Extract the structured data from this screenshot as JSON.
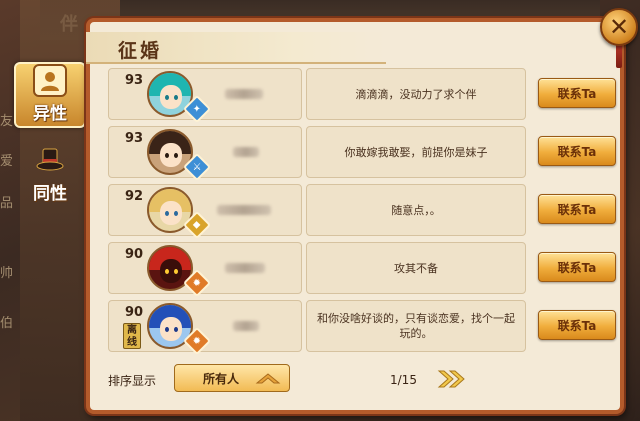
{
  "background": {
    "partial_title": "伴",
    "edge_chars": [
      "友",
      "爱",
      "品",
      "帅",
      "伯"
    ]
  },
  "side_tabs": [
    {
      "label": "异性",
      "icon": "person-silhouette-icon",
      "active": true
    },
    {
      "label": "同性",
      "icon": "top-hat-icon",
      "active": false
    }
  ],
  "dialog": {
    "title": "征婚",
    "close_icon": "close-x-icon"
  },
  "rows": [
    {
      "level": "93",
      "avatar": "teal-twin-tail-girl",
      "badge": "star",
      "message": "滴滴滴，没动力了求个伴",
      "button": "联系Ta",
      "offline": ""
    },
    {
      "level": "93",
      "avatar": "dark-hair-boy-with-headdress",
      "badge": "sword",
      "message": "你敢嫁我敢娶，前提你是妹子",
      "button": "联系Ta",
      "offline": ""
    },
    {
      "level": "92",
      "avatar": "blonde-boy",
      "badge": "diamond",
      "message": "随意点，。",
      "button": "联系Ta",
      "offline": ""
    },
    {
      "level": "90",
      "avatar": "red-hooded-figure",
      "badge": "flame",
      "message": "攻其不备",
      "button": "联系Ta",
      "offline": ""
    },
    {
      "level": "90",
      "avatar": "blue-hair-boy",
      "badge": "flame",
      "message": "和你没啥好谈的，只有谈恋爱，找个一起玩的。",
      "button": "联系Ta",
      "offline": "离线"
    }
  ],
  "footer": {
    "sort_label": "排序显示",
    "sort_value": "所有人",
    "page": "1/15",
    "next_icon": "double-chevron-right-icon"
  },
  "colors": {
    "frame": "#b45b2b",
    "panel": "#f4ead7",
    "card": "#efe2c9",
    "button": "#f0ad3c"
  }
}
